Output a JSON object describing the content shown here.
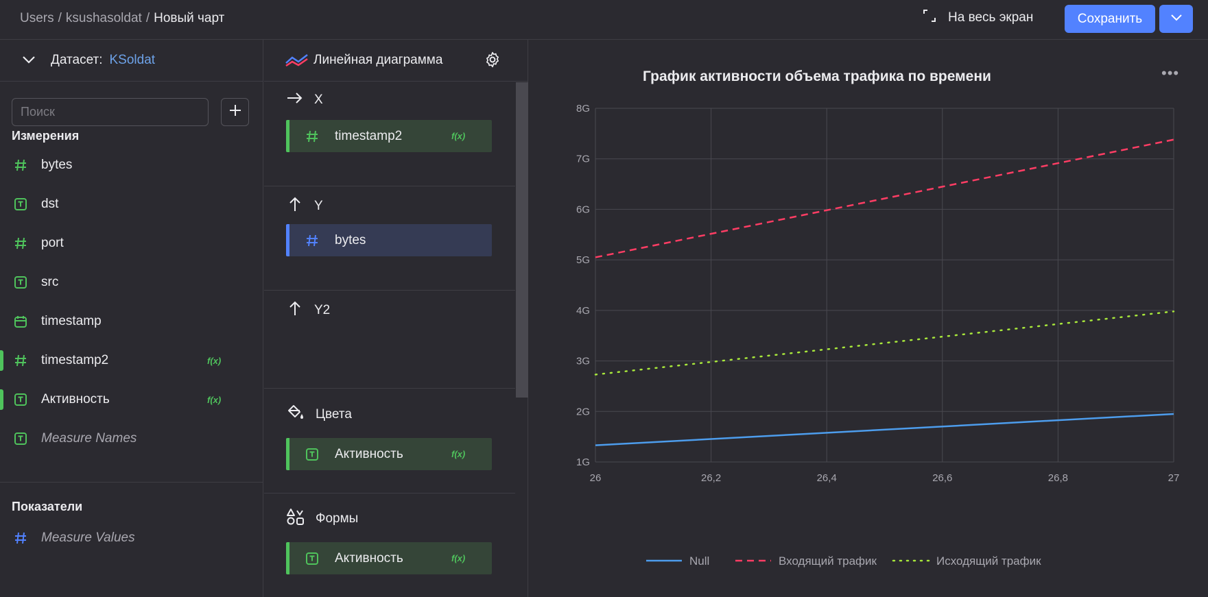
{
  "header": {
    "breadcrumb": [
      "Users",
      "ksushasoldat",
      "Новый чарт"
    ],
    "fullscreen_label": "На весь экран",
    "save_label": "Сохранить"
  },
  "dataset": {
    "label": "Датасет:",
    "name": "KSoldat"
  },
  "search": {
    "placeholder": "Поиск"
  },
  "dimensions": {
    "title": "Измерения",
    "items": [
      {
        "name": "bytes",
        "type": "number"
      },
      {
        "name": "dst",
        "type": "text"
      },
      {
        "name": "port",
        "type": "number"
      },
      {
        "name": "src",
        "type": "text"
      },
      {
        "name": "timestamp",
        "type": "date"
      },
      {
        "name": "timestamp2",
        "type": "number",
        "formula": "f(x)"
      },
      {
        "name": "Активность",
        "type": "text",
        "formula": "f(x)"
      },
      {
        "name": "Measure Names",
        "type": "text"
      }
    ]
  },
  "measures": {
    "title": "Показатели",
    "items": [
      {
        "name": "Measure Values",
        "type": "number"
      }
    ]
  },
  "visualization": {
    "type_label": "Линейная диаграмма",
    "sections": {
      "x": {
        "label": "X",
        "field": "timestamp2",
        "formula": "f(x)"
      },
      "y": {
        "label": "Y",
        "field": "bytes"
      },
      "y2": {
        "label": "Y2"
      },
      "colors": {
        "label": "Цвета",
        "field": "Активность",
        "formula": "f(x)"
      },
      "shapes": {
        "label": "Формы",
        "field": "Активность",
        "formula": "f(x)"
      }
    }
  },
  "colors": {
    "accent": "#5282ff",
    "formula": "#4fc35c",
    "null_line": "#4d9ded",
    "incoming_line": "#ff3d64",
    "outgoing_line": "#a8e83b"
  },
  "chart_data": {
    "type": "line",
    "title": "График активности объема трафика по времени",
    "x": [
      26,
      27
    ],
    "x_ticks": [
      "26",
      "26,2",
      "26,4",
      "26,6",
      "26,8",
      "27"
    ],
    "y_ticks": [
      "1G",
      "2G",
      "3G",
      "4G",
      "5G",
      "6G",
      "7G",
      "8G"
    ],
    "ylim": [
      1,
      8
    ],
    "xlim": [
      26,
      27
    ],
    "series": [
      {
        "name": "Null",
        "values": [
          1.33,
          1.95
        ],
        "style": "solid",
        "color": "#4d9ded"
      },
      {
        "name": "Входящий трафик",
        "values": [
          5.05,
          7.38
        ],
        "style": "dashed",
        "color": "#ff3d64"
      },
      {
        "name": "Исходящий трафик",
        "values": [
          2.73,
          3.98
        ],
        "style": "dotted",
        "color": "#a8e83b"
      }
    ],
    "legend_position": "bottom-center",
    "grid": true
  }
}
